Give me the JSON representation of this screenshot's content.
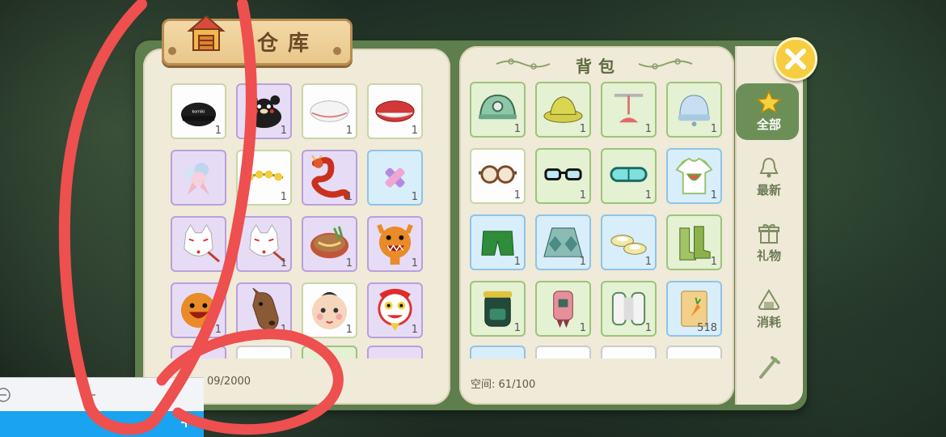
{
  "warehouse": {
    "title": "仓库",
    "capacity_label": "09/2000",
    "items": [
      {
        "name": "black-cap",
        "count": "1",
        "rarity": "white"
      },
      {
        "name": "bear-cap",
        "count": "1",
        "rarity": "purple"
      },
      {
        "name": "white-beret",
        "count": "1",
        "rarity": "white"
      },
      {
        "name": "red-beret",
        "count": "1",
        "rarity": "white"
      },
      {
        "name": "flower-corsage",
        "count": "",
        "rarity": "purple"
      },
      {
        "name": "flower-garland",
        "count": "1",
        "rarity": "white"
      },
      {
        "name": "dragon-toy",
        "count": "1",
        "rarity": "purple"
      },
      {
        "name": "bandage-sticker",
        "count": "1",
        "rarity": "blue"
      },
      {
        "name": "fox-mask",
        "count": "",
        "rarity": "purple"
      },
      {
        "name": "fox-mask",
        "count": "1",
        "rarity": "purple"
      },
      {
        "name": "noodle-bowl",
        "count": "1",
        "rarity": "purple"
      },
      {
        "name": "tiger-mask",
        "count": "1",
        "rarity": "purple"
      },
      {
        "name": "tiger-head",
        "count": "1",
        "rarity": "purple"
      },
      {
        "name": "horse-mask",
        "count": "1",
        "rarity": "purple"
      },
      {
        "name": "baby-face-mask",
        "count": "1",
        "rarity": "white"
      },
      {
        "name": "lion-dance-head",
        "count": "1",
        "rarity": "purple"
      }
    ]
  },
  "backpack": {
    "title": "背包",
    "capacity_prefix": "空间:",
    "capacity_value": "61/100",
    "items": [
      {
        "name": "miner-helmet",
        "count": "1",
        "rarity": "green"
      },
      {
        "name": "straw-hat",
        "count": "1",
        "rarity": "green"
      },
      {
        "name": "propeller-hat",
        "count": "1",
        "rarity": "green"
      },
      {
        "name": "knit-beanie",
        "count": "1",
        "rarity": "green"
      },
      {
        "name": "aviator-goggles",
        "count": "1",
        "rarity": "white"
      },
      {
        "name": "teal-glasses",
        "count": "1",
        "rarity": "green"
      },
      {
        "name": "swim-goggles",
        "count": "1",
        "rarity": "green"
      },
      {
        "name": "watermelon-tshirt",
        "count": "1",
        "rarity": "blue"
      },
      {
        "name": "green-shorts",
        "count": "1",
        "rarity": "blue"
      },
      {
        "name": "argyle-skirt",
        "count": "1",
        "rarity": "blue"
      },
      {
        "name": "flat-shoes",
        "count": "1",
        "rarity": "blue"
      },
      {
        "name": "rain-boots",
        "count": "1",
        "rarity": "green"
      },
      {
        "name": "explorer-backpack",
        "count": "1",
        "rarity": "green"
      },
      {
        "name": "jetpack",
        "count": "1",
        "rarity": "green"
      },
      {
        "name": "white-jetpack",
        "count": "1",
        "rarity": "green"
      },
      {
        "name": "carrot-seeds",
        "count": "518",
        "rarity": "blue"
      }
    ]
  },
  "sidebar": {
    "items": [
      {
        "label": "全部",
        "icon": "star-icon",
        "active": true
      },
      {
        "label": "最新",
        "icon": "bell-icon"
      },
      {
        "label": "礼物",
        "icon": "gift-icon"
      },
      {
        "label": "消耗",
        "icon": "rice-ball-icon"
      },
      {
        "label": "",
        "icon": "tool-icon"
      }
    ]
  },
  "colors": {
    "frame": "#5e7e4d",
    "panel": "#f0ead8",
    "scribble": "#ee4f4f",
    "close_button": "#f6cd3e"
  }
}
